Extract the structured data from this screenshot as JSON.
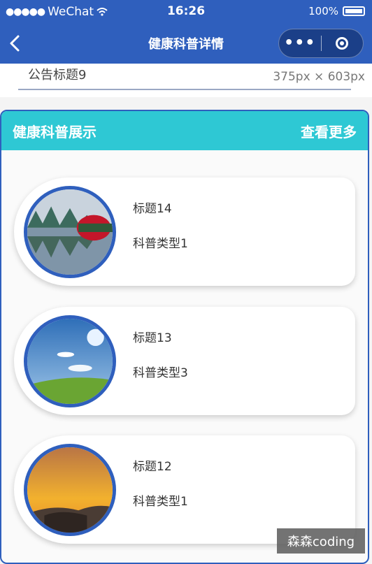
{
  "status_bar": {
    "carrier": "WeChat",
    "time": "16:26",
    "battery": "100%"
  },
  "nav": {
    "title": "健康科普详情"
  },
  "notice": {
    "text": "公告标题9",
    "size_label": "375px × 603px"
  },
  "section": {
    "title": "健康科普展示",
    "more": "查看更多"
  },
  "articles": [
    {
      "title": "标题14",
      "type": "科普类型1",
      "image": "lake-landscape"
    },
    {
      "title": "标题13",
      "type": "科普类型3",
      "image": "blue-sky-meadow"
    },
    {
      "title": "标题12",
      "type": "科普类型1",
      "image": "sunset-rocks"
    }
  ],
  "watermark": "森森coding",
  "colors": {
    "nav_blue": "#2f5fbd",
    "header_teal": "#2ec8d4"
  }
}
